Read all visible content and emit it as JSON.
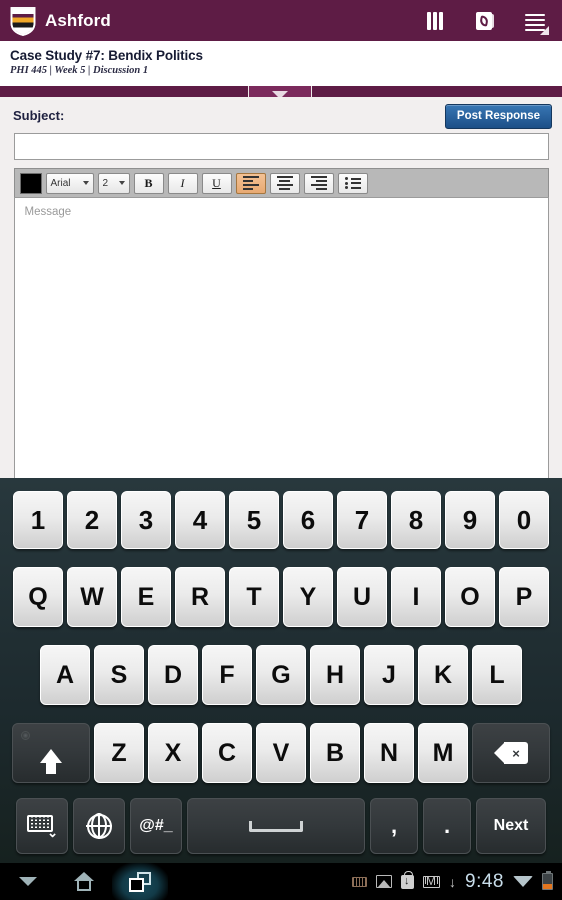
{
  "header": {
    "brand": "Ashford",
    "logo_name": "ashford-shield-logo",
    "icons": [
      {
        "name": "library-books-icon",
        "label": "Library"
      },
      {
        "name": "contact-phone-icon",
        "label": "Contact"
      },
      {
        "name": "hamburger-menu-icon",
        "label": "Menu"
      }
    ],
    "bar_color": "#5e1c45"
  },
  "title_block": {
    "title": "Case Study #7: Bendix Politics",
    "subtitle": "PHI 445  |  Week 5  |  Discussion 1"
  },
  "tab_pull": {
    "name": "collapse-handle",
    "glyph": "chevron-down-icon"
  },
  "compose": {
    "subject_label": "Subject:",
    "subject_value": "",
    "subject_placeholder": "",
    "post_button": "Post Response",
    "post_button_color": "#2a63a0",
    "message_placeholder": "Message",
    "message_value": "",
    "toolbar": {
      "color_swatch": "#000000",
      "font_family_value": "Arial",
      "font_size_value": "2",
      "bold": "B",
      "italic": "I",
      "underline": "U",
      "align_left": "align-left",
      "align_center": "align-center",
      "align_right": "align-right",
      "bullet_list": "bulleted-list",
      "active_button": "align-left",
      "active_color": "#e8a972"
    }
  },
  "keyboard": {
    "row_numbers": [
      "1",
      "2",
      "3",
      "4",
      "5",
      "6",
      "7",
      "8",
      "9",
      "0"
    ],
    "row_top": [
      "Q",
      "W",
      "E",
      "R",
      "T",
      "Y",
      "U",
      "I",
      "O",
      "P"
    ],
    "row_home": [
      "A",
      "S",
      "D",
      "F",
      "G",
      "H",
      "J",
      "K",
      "L"
    ],
    "row_bottom": [
      "Z",
      "X",
      "C",
      "V",
      "B",
      "N",
      "M"
    ],
    "shift_label": "shift-icon",
    "backspace_label": "backspace-icon",
    "bottom_row": {
      "hide_keyboard": "hide-keyboard-icon",
      "language": "globe-icon",
      "symbols": "@#_",
      "space": "space-icon",
      "comma": ",",
      "period": ".",
      "next": "Next"
    },
    "background_color": "#1d2a2e"
  },
  "navbar": {
    "back": "chevron-down-icon",
    "home": "home-icon",
    "recents": "recents-icon",
    "status": {
      "icons": [
        "keyboard-active-icon",
        "screenshot-image-icon",
        "play-store-download-icon",
        "gmail-icon",
        "download-icon"
      ],
      "time": "9:48",
      "wifi": "wifi-icon",
      "battery": "battery-low-icon",
      "battery_color": "#e3761f"
    }
  }
}
